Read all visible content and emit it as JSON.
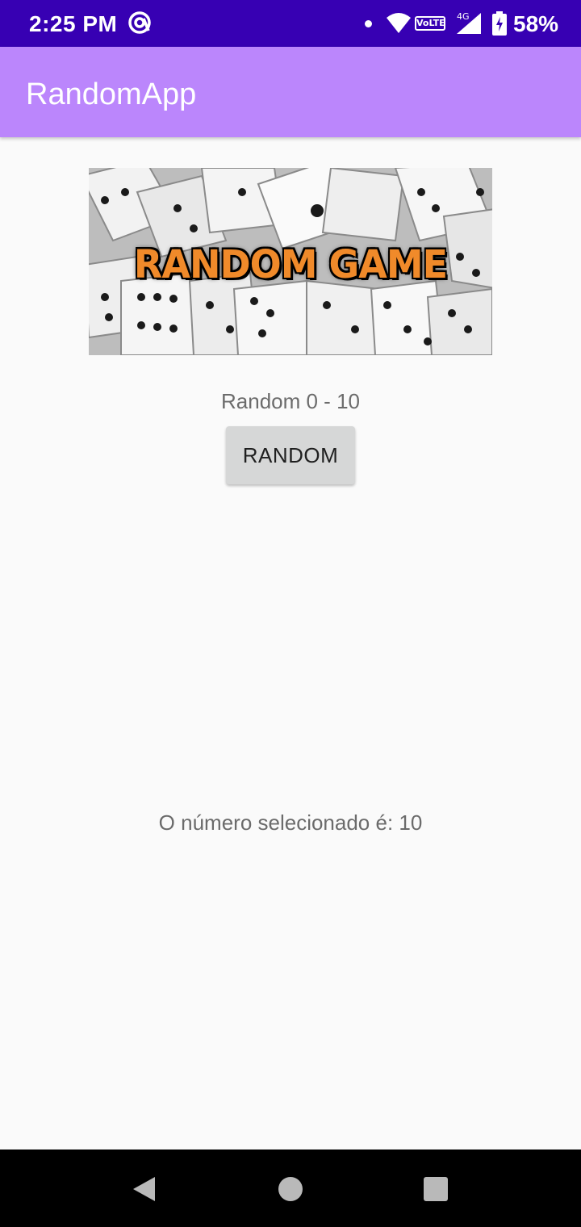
{
  "status_bar": {
    "time": "2:25 PM",
    "volte": "VoLTE",
    "network": "4G",
    "battery": "58%",
    "icons": [
      "at-sign-icon",
      "notification-dot-icon",
      "wifi-icon",
      "volte-icon",
      "signal-icon",
      "battery-charging-icon"
    ]
  },
  "app_bar": {
    "title": "RandomApp",
    "color": "#bb86fc"
  },
  "banner": {
    "text": "RANDOM GAME",
    "text_color": "#f08a2a"
  },
  "main": {
    "range_label": "Random 0 - 10",
    "button_label": "RANDOM",
    "result_text": "O número selecionado é: 10"
  },
  "nav_bar": {
    "icons": [
      "back-icon",
      "home-icon",
      "recents-icon"
    ]
  },
  "colors": {
    "status_bar": "#3700b3",
    "background": "#fafafa",
    "button": "#d6d7d7"
  }
}
